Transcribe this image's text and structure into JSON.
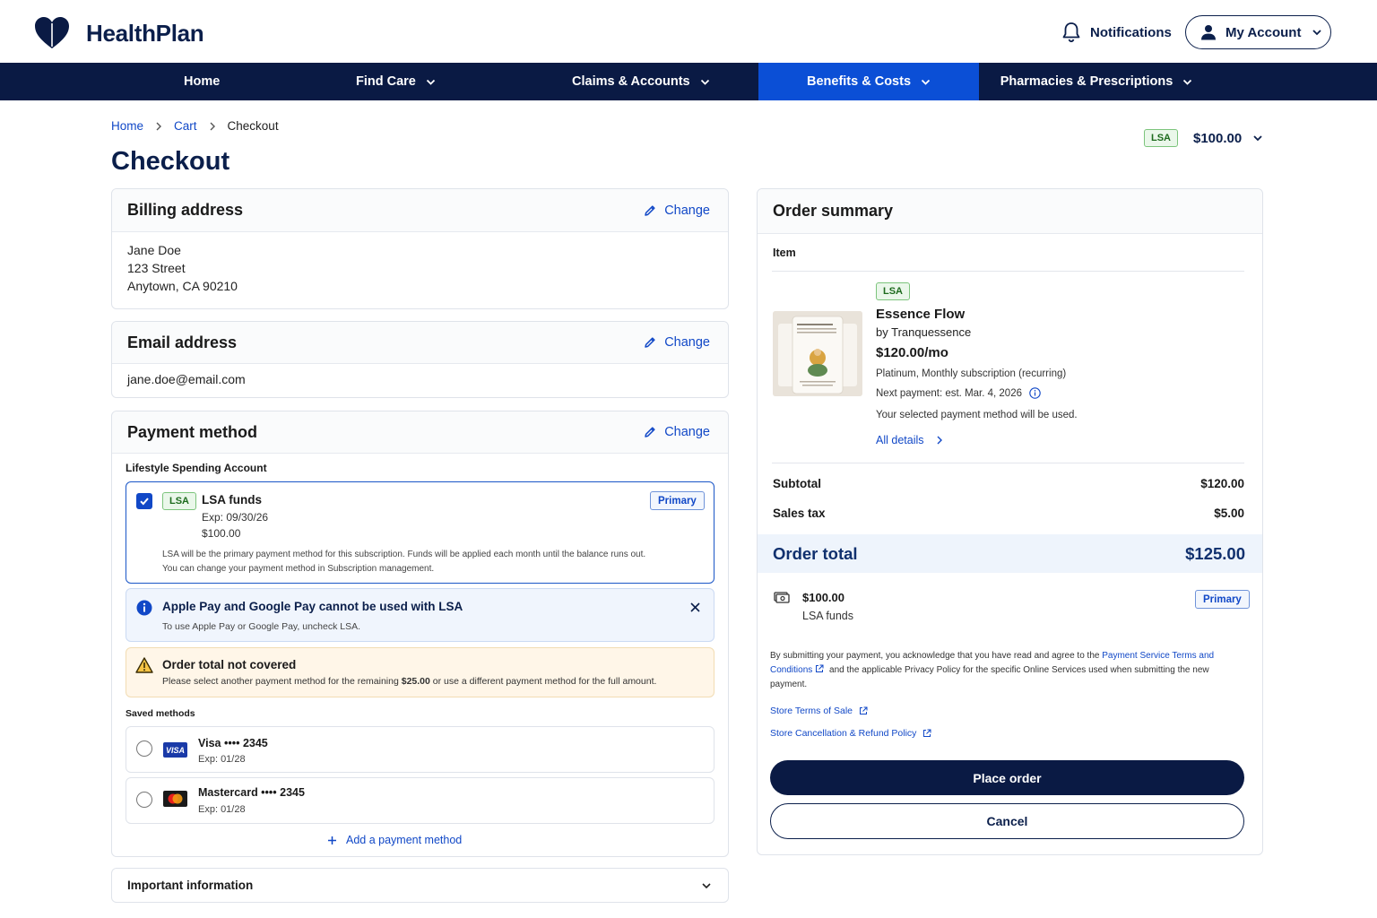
{
  "brand": {
    "name": "HealthPlan",
    "color": "#0a1a44",
    "accent": "#0b4fd6"
  },
  "header": {
    "notifications_label": "Notifications",
    "account_label": "My Account"
  },
  "nav": {
    "items": [
      {
        "label": "Home",
        "has_dropdown": false
      },
      {
        "label": "Find Care",
        "has_dropdown": true
      },
      {
        "label": "Claims & Accounts",
        "has_dropdown": true
      },
      {
        "label": "Benefits & Costs",
        "has_dropdown": true,
        "active": true
      },
      {
        "label": "Pharmacies & Prescriptions",
        "has_dropdown": true
      }
    ]
  },
  "breadcrumb": {
    "items": [
      "Home",
      "Cart",
      "Checkout"
    ]
  },
  "page": {
    "title": "Checkout"
  },
  "balance": {
    "badge": "LSA",
    "amount": "$100.00"
  },
  "billing": {
    "title": "Billing address",
    "change_label": "Change",
    "lines": [
      "Jane Doe",
      "123 Street",
      "Anytown, CA 90210"
    ]
  },
  "email": {
    "title": "Email address",
    "change_label": "Change",
    "value": "jane.doe@email.com"
  },
  "payment": {
    "title": "Payment method",
    "change_label": "Change",
    "lsa_section_label": "Lifestyle Spending Account",
    "lsa": {
      "badge": "LSA",
      "name": "LSA funds",
      "expiry": "Exp: 09/30/26",
      "amount": "$100.00",
      "primary_badge": "Primary",
      "checked": true,
      "note_line1": "LSA will be the primary payment method for this subscription. Funds will be applied each month until the balance runs out.",
      "note_line2": "You can change your payment method in Subscription management."
    },
    "info_banner": {
      "title": "Apple Pay and Google Pay cannot be used with LSA",
      "text": "To use Apple Pay or Google Pay, uncheck LSA."
    },
    "warning_banner": {
      "title": "Order total not covered",
      "text_before": "Please select another payment method for the remaining",
      "text_amount": "$25.00",
      "text_after": "or use a different payment method for the full amount."
    },
    "saved_label": "Saved methods",
    "saved_methods": [
      {
        "brand": "Visa",
        "name": "Visa •••• 2345",
        "expiry": "Exp: 01/28",
        "logo_text": "VISA"
      },
      {
        "brand": "Mastercard",
        "name": "Mastercard •••• 2345",
        "expiry": "Exp: 01/28"
      }
    ],
    "add_label": "Add a payment method"
  },
  "important": {
    "title": "Important information"
  },
  "summary": {
    "title": "Order summary",
    "item_header": "Item",
    "item": {
      "badge": "LSA",
      "name": "Essence Flow",
      "by": "by Tranquessence",
      "price": "$120.00/mo",
      "plan": "Platinum, Monthly subscription (recurring)",
      "next_payment": "Next payment: est. Mar. 4, 2026",
      "payment_note": "Your selected payment method will be used.",
      "details_link": "All details"
    },
    "subtotal_label": "Subtotal",
    "subtotal_value": "$120.00",
    "tax_label": "Sales tax",
    "tax_value": "$5.00",
    "total_label": "Order total",
    "total_value": "$125.00",
    "applied": {
      "amount": "$100.00",
      "source": "LSA funds",
      "badge": "Primary"
    },
    "legal_text_1": "By submitting your payment, you acknowledge that you have read and agree to the",
    "legal_link": "Payment Service Terms and Conditions",
    "legal_text_2": "and the applicable Privacy Policy for the specific Online Services used when submitting the new payment.",
    "terms_link": "Store Terms of Sale",
    "refund_link": "Store Cancellation & Refund Policy",
    "place_order_label": "Place order",
    "cancel_label": "Cancel"
  }
}
